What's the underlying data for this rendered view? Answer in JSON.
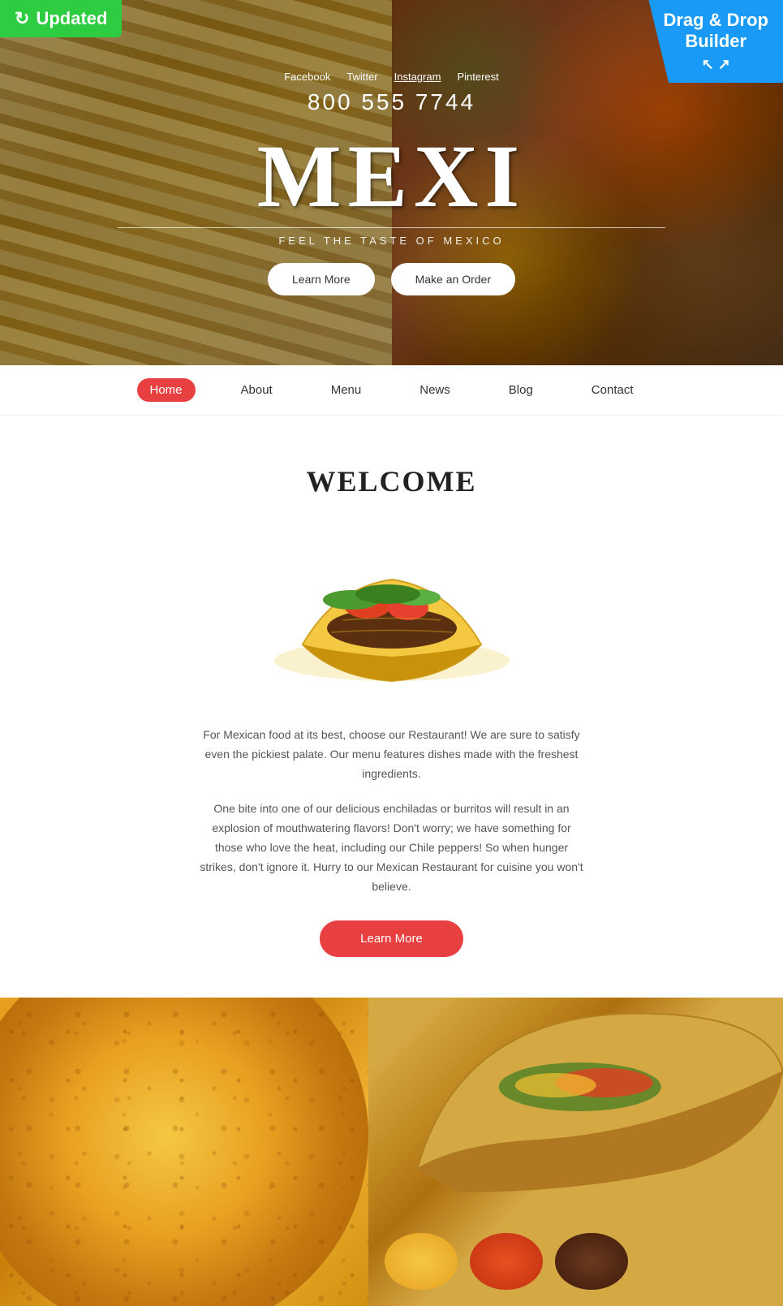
{
  "badges": {
    "updated": "Updated",
    "dnd": "Drag & Drop\nBuilder"
  },
  "hero": {
    "social_links": [
      "Facebook",
      "Twitter",
      "Instagram",
      "Pinterest"
    ],
    "phone": "800 555 7744",
    "title": "MEXI",
    "divider": true,
    "subtitle": "FEEL THE TASTE OF MEXICO",
    "btn_learn": "Learn More",
    "btn_order": "Make an Order"
  },
  "nav": {
    "items": [
      "Home",
      "About",
      "Menu",
      "News",
      "Blog",
      "Contact"
    ],
    "active": "Home"
  },
  "welcome": {
    "title": "WELCOME",
    "text1": "For Mexican food at its best, choose our Restaurant! We are sure to satisfy even the pickiest palate. Our menu features dishes made with the freshest ingredients.",
    "text2": "One bite into one of our delicious enchiladas or burritos will result in an explosion of mouthwatering flavors! Don't worry; we have something for those who love the heat, including our Chile peppers! So when hunger strikes, don't ignore it. Hurry to our Mexican Restaurant for cuisine you won't believe.",
    "btn_learn": "Learn More"
  }
}
